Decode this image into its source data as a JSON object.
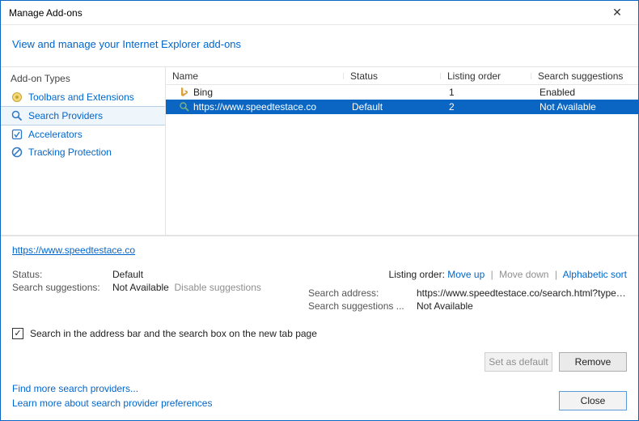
{
  "titlebar": {
    "title": "Manage Add-ons"
  },
  "header": {
    "manage_link": "View and manage your Internet Explorer add-ons"
  },
  "sidebar": {
    "group_label": "Add-on Types",
    "items": [
      {
        "label": "Toolbars and Extensions"
      },
      {
        "label": "Search Providers"
      },
      {
        "label": "Accelerators"
      },
      {
        "label": "Tracking Protection"
      }
    ]
  },
  "table": {
    "headers": {
      "name": "Name",
      "status": "Status",
      "order": "Listing order",
      "sugg": "Search suggestions"
    },
    "rows": [
      {
        "name": "Bing",
        "status": "",
        "order": "1",
        "sugg": "Enabled",
        "selected": false
      },
      {
        "name": "https://www.speedtestace.co",
        "status": "Default",
        "order": "2",
        "sugg": "Not Available",
        "selected": true
      }
    ]
  },
  "selection": {
    "title_link": "https://www.speedtestace.co",
    "left": {
      "status_label": "Status:",
      "status_value": "Default",
      "sugg_label": "Search suggestions:",
      "sugg_value": "Not Available",
      "disable_sugg": "Disable suggestions"
    },
    "right": {
      "listing_label": "Listing order:",
      "move_up": "Move up",
      "move_down": "Move down",
      "alpha": "Alphabetic sort",
      "addr_label": "Search address:",
      "addr_value": "https://www.speedtestace.co/search.html?type=se...",
      "sugg2_label": "Search suggestions ...",
      "sugg2_value": "Not Available"
    },
    "checkbox_label": "Search in the address bar and the search box on the new tab page",
    "set_default": "Set as default",
    "remove": "Remove"
  },
  "footer": {
    "find_more": "Find more search providers...",
    "learn_more": "Learn more about search provider preferences",
    "close": "Close"
  }
}
